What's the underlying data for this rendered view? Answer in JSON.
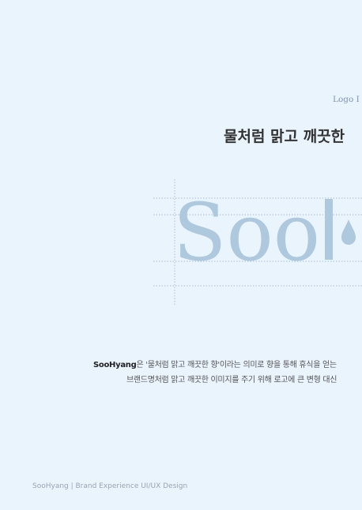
{
  "section_label": "Logo I",
  "title": "물처럼 맑고 깨끗한",
  "logo": {
    "text": "Sool",
    "color": "#aec8dd",
    "guide_color": "#a9bcd4"
  },
  "description": {
    "brand": "SooHyang",
    "line1_rest": "은 '물처럼 맑고 깨끗한 향'이라는 의미로 향을 통해 휴식을 얻는",
    "line2": "브랜드명처럼 맑고 깨끗한 이미지를 주기 위해 로고에 큰 변형 대신"
  },
  "footer": "SooHyang | Brand Experience UI/UX Design"
}
